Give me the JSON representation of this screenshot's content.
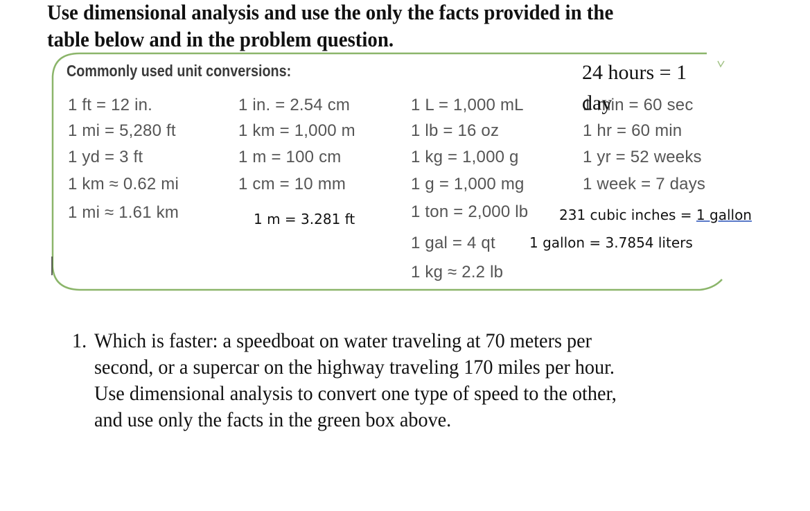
{
  "instruction": {
    "line1": "Use dimensional analysis and use the only the facts provided in the",
    "line2": "table below and in the problem question."
  },
  "conversion_box": {
    "title": "Commonly used unit conversions:",
    "border_color": "#8bb56a",
    "day_note": "24 hours = 1 day",
    "columns": [
      [
        "1 ft = 12 in.",
        "1 mi = 5,280 ft",
        "1 yd = 3 ft",
        "1 km ≈ 0.62 mi",
        "1 mi ≈ 1.61 km"
      ],
      [
        "1 in. = 2.54 cm",
        "1 km = 1,000 m",
        "1 m = 100 cm",
        "1 cm = 10 mm"
      ],
      [
        "1 L = 1,000 mL",
        "1 lb = 16 oz",
        "1 kg = 1,000 g",
        "1 g = 1,000 mg",
        "1 ton = 2,000 lb",
        "1 gal = 4 qt",
        "1 kg ≈ 2.2 lb"
      ],
      [
        "1 min = 60 sec",
        "1 hr = 60 min",
        "1 yr = 52 weeks",
        "1 week = 7 days"
      ]
    ],
    "added_notes": {
      "meter_feet": "1 m = 3.281 ft",
      "cubic_inches_prefix": "231 cubic inches = ",
      "cubic_inches_suffix": "1 gallon",
      "gallon_liters": "1 gallon = 3.7854 liters"
    }
  },
  "question": {
    "number": "1.",
    "line1": "Which is faster: a speedboat on water traveling at 70 meters per",
    "line2": "second, or a supercar on the highway traveling 170 miles per hour.",
    "line3": "Use dimensional analysis to convert one type of speed to the other,",
    "line4": "and use only the facts in the green box above."
  }
}
